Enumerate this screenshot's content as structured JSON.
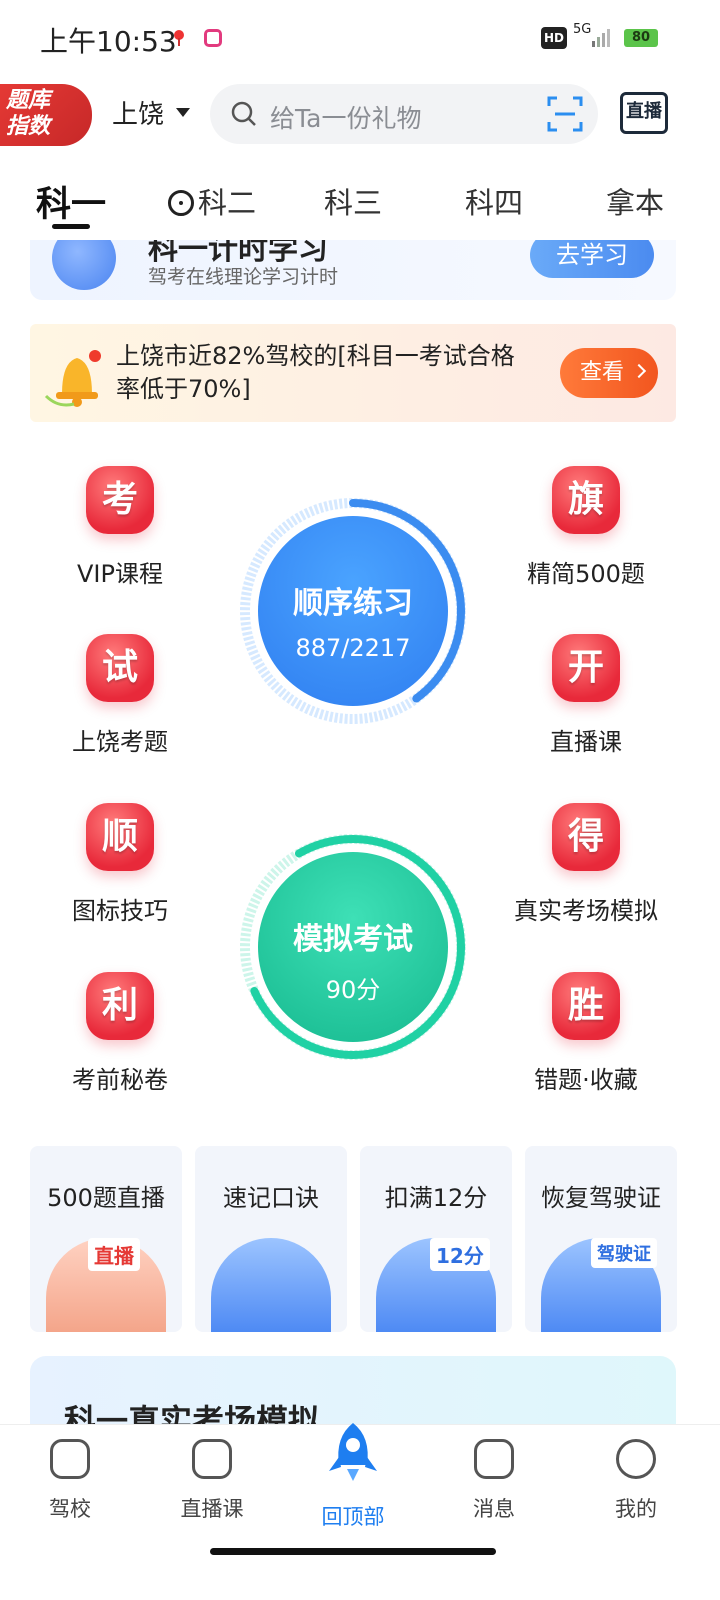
{
  "status_bar": {
    "time": "上午10:53",
    "hd": "HD",
    "network": "5G",
    "battery": "80"
  },
  "header": {
    "logo_line1": "题库",
    "logo_line2": "指数",
    "city": "上饶",
    "search_placeholder": "给Ta一份礼物",
    "live_label": "直播"
  },
  "tabs": [
    "科一",
    "科二",
    "科三",
    "科四",
    "拿本"
  ],
  "timer_card": {
    "title": "科一计时学习",
    "subtitle": "驾考在线理论学习计时",
    "button": "去学习"
  },
  "notice": {
    "text": "上饶市近82%驾校的[科目一考试合格率低于70%]",
    "button": "查看"
  },
  "features_left": [
    {
      "badge": "考",
      "label": "VIP课程"
    },
    {
      "badge": "试",
      "label": "上饶考题"
    },
    {
      "badge": "顺",
      "label": "图标技巧"
    },
    {
      "badge": "利",
      "label": "考前秘卷"
    }
  ],
  "features_right": [
    {
      "badge": "旗",
      "label": "精简500题"
    },
    {
      "badge": "开",
      "label": "直播课"
    },
    {
      "badge": "得",
      "label": "真实考场模拟"
    },
    {
      "badge": "胜",
      "label": "错题·收藏"
    }
  ],
  "practice": {
    "title": "顺序练习",
    "progress": "887/2217",
    "done": 887,
    "total": 2217
  },
  "exam": {
    "title": "模拟考试",
    "score": "90分"
  },
  "promos": [
    {
      "title": "500题直播",
      "tag": "直播"
    },
    {
      "title": "速记口诀",
      "tag": ""
    },
    {
      "title": "扣满12分",
      "tag": "12分"
    },
    {
      "title": "恢复驾驶证",
      "tag": "驾驶证"
    }
  ],
  "bottom_card": {
    "title": "科一真实考场模拟"
  },
  "tabbar": [
    "驾校",
    "直播课",
    "回顶部",
    "消息",
    "我的"
  ],
  "colors": {
    "accent": "#1e7ef0",
    "badge_red": "#e8293a",
    "exam_green": "#22c7a0",
    "practice_blue": "#3b8cf0"
  }
}
